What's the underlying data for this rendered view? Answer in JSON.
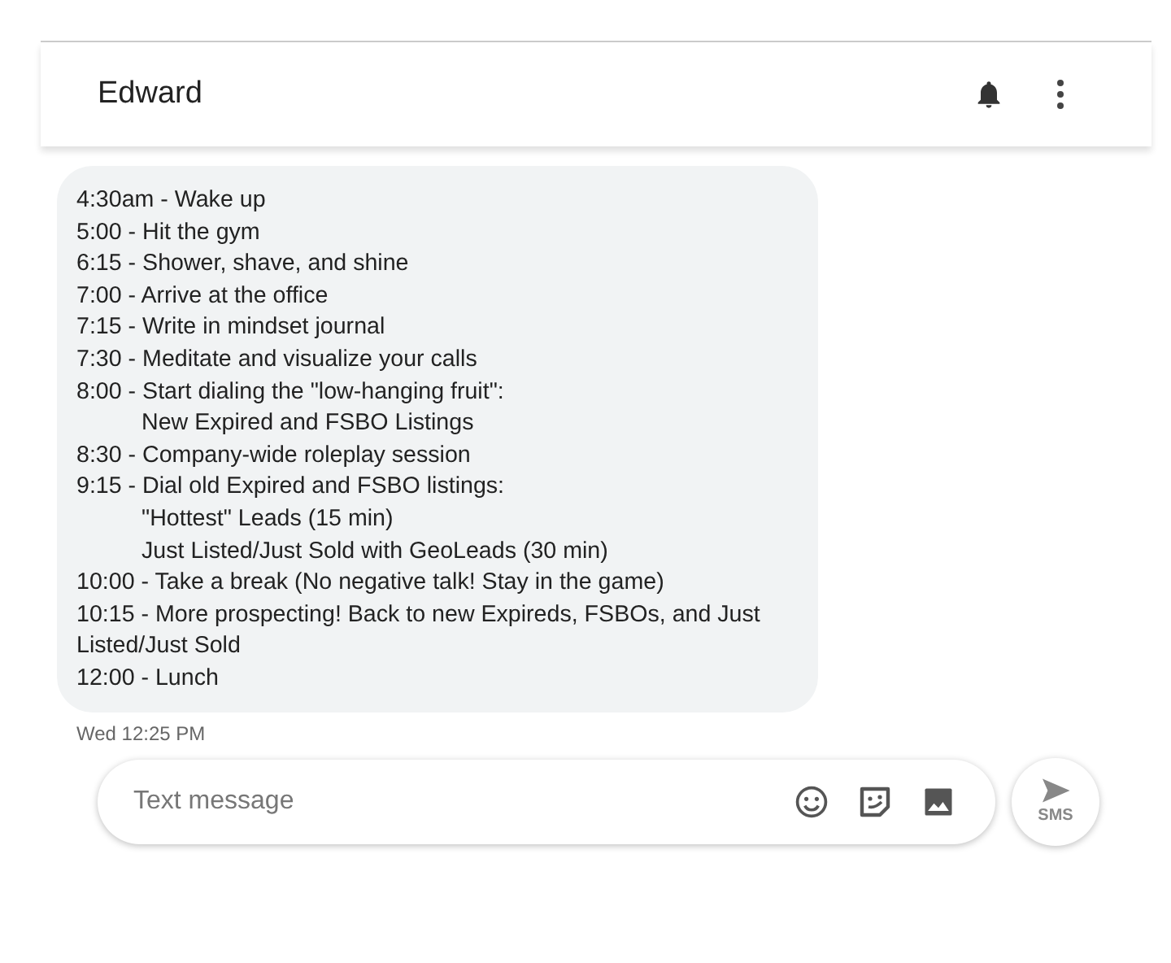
{
  "header": {
    "title": "Edward"
  },
  "message": {
    "lines": [
      {
        "text": "4:30am - Wake up",
        "indented": false
      },
      {
        "text": "5:00 - Hit the gym",
        "indented": false
      },
      {
        "text": "6:15 - Shower, shave, and shine",
        "indented": false
      },
      {
        "text": "7:00 - Arrive at the office",
        "indented": false
      },
      {
        "text": "7:15 - Write in mindset journal",
        "indented": false
      },
      {
        "text": "7:30 - Meditate and visualize your calls",
        "indented": false
      },
      {
        "text": "8:00 - Start dialing the \"low-hanging fruit\":",
        "indented": false
      },
      {
        "text": "New Expired and FSBO Listings",
        "indented": true
      },
      {
        "text": "8:30 - Company-wide roleplay session",
        "indented": false
      },
      {
        "text": "9:15 - Dial old Expired and FSBO listings:",
        "indented": false
      },
      {
        "text": "\"Hottest\" Leads (15 min)",
        "indented": true
      },
      {
        "text": "Just Listed/Just Sold with GeoLeads (30 min)",
        "indented": true
      },
      {
        "text": "10:00 - Take a break (No negative talk! Stay in the game)",
        "indented": false
      },
      {
        "text": "10:15 - More prospecting! Back to new Expireds, FSBOs, and Just Listed/Just Sold",
        "indented": false
      },
      {
        "text": "12:00 - Lunch",
        "indented": false
      }
    ],
    "timestamp": "Wed 12:25 PM"
  },
  "composer": {
    "placeholder": "Text message",
    "send_label": "SMS"
  }
}
